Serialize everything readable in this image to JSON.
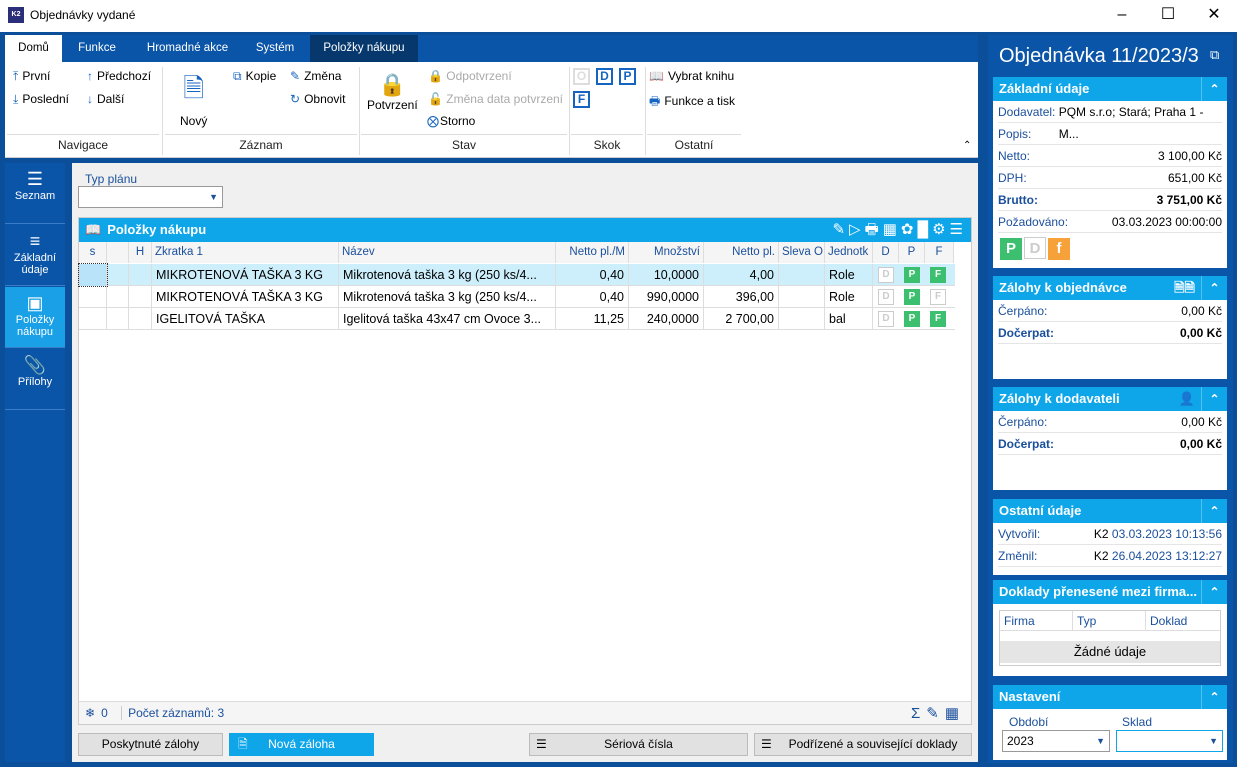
{
  "window": {
    "title": "Objednávky vydané",
    "logo": "K2"
  },
  "tabs": [
    "Domů",
    "Funkce",
    "Hromadné akce",
    "Systém",
    "Položky nákupu"
  ],
  "ribbon": {
    "nav": {
      "first": "První",
      "prev": "Předchozí",
      "last": "Poslední",
      "next": "Další",
      "group": "Navigace"
    },
    "record": {
      "new": "Nový",
      "copy": "Kopie",
      "edit": "Změna",
      "refresh": "Obnovit",
      "group": "Záznam"
    },
    "state": {
      "confirm": "Potvrzení",
      "unconfirm": "Odpotvrzení",
      "change_date": "Změna data potvrzení",
      "cancel": "Storno",
      "group": "Stav"
    },
    "jump": {
      "o": "O",
      "d": "D",
      "p": "P",
      "f": "F",
      "group": "Skok"
    },
    "other": {
      "book": "Vybrat knihu",
      "print": "Funkce a tisk",
      "group": "Ostatní"
    }
  },
  "sidebar": [
    {
      "label": "Seznam",
      "icon": "list-icon"
    },
    {
      "label": "Základní údaje",
      "icon": "details-icon"
    },
    {
      "label": "Položky nákupu",
      "icon": "box-icon"
    },
    {
      "label": "Přílohy",
      "icon": "paperclip-icon"
    }
  ],
  "filter": {
    "label": "Typ plánu",
    "value": ""
  },
  "grid": {
    "title": "Položky nákupu",
    "columns": [
      "s",
      "",
      "H",
      "Zkratka 1",
      "Název",
      "Netto pl./M",
      "Množství",
      "Netto pl.",
      "Sleva O",
      "Jednotk",
      "D",
      "P",
      "F"
    ],
    "rows": [
      {
        "zkratka": "MIKROTENOVÁ TAŠKA 3 KG",
        "nazev": "Mikrotenová taška 3 kg (250 ks/4...",
        "netto_m": "0,40",
        "mnozstvi": "10,0000",
        "netto": "4,00",
        "sleva": "",
        "jednotka": "Role",
        "d": "D",
        "p": "P",
        "f": "F",
        "f_on": true,
        "selected": true
      },
      {
        "zkratka": "MIKROTENOVÁ TAŠKA 3 KG",
        "nazev": "Mikrotenová taška 3 kg (250 ks/4...",
        "netto_m": "0,40",
        "mnozstvi": "990,0000",
        "netto": "396,00",
        "sleva": "",
        "jednotka": "Role",
        "d": "D",
        "p": "P",
        "f": "F",
        "f_on": false,
        "selected": false
      },
      {
        "zkratka": "IGELITOVÁ TAŠKA",
        "nazev": "Igelitová taška 43x47 cm Ovoce 3...",
        "netto_m": "11,25",
        "mnozstvi": "240,0000",
        "netto": "2 700,00",
        "sleva": "",
        "jednotka": "bal",
        "d": "D",
        "p": "P",
        "f": "F",
        "f_on": true,
        "selected": false
      }
    ],
    "footer": {
      "count": "0",
      "records": "Počet záznamů: 3"
    }
  },
  "buttons": {
    "advances": "Poskytnuté zálohy",
    "new_advance": "Nová záloha",
    "serial": "Sériová čísla",
    "related": "Podřízené a související doklady"
  },
  "right": {
    "title": "Objednávka 11/2023/3",
    "basic": {
      "head": "Základní údaje",
      "supplier_k": "Dodavatel:",
      "supplier_v": "PQM s.r.o; Stará; Praha 1 - M...",
      "desc_k": "Popis:",
      "netto_k": "Netto:",
      "netto_v": "3 100,00 Kč",
      "dph_k": "DPH:",
      "dph_v": "651,00 Kč",
      "brutto_k": "Brutto:",
      "brutto_v": "3 751,00 Kč",
      "req_k": "Požadováno:",
      "req_v": "03.03.2023 00:00:00",
      "flags": [
        "P",
        "D",
        "f"
      ]
    },
    "adv_order": {
      "head": "Zálohy k objednávce",
      "k1": "Čerpáno:",
      "v1": "0,00 Kč",
      "k2": "Dočerpat:",
      "v2": "0,00 Kč"
    },
    "adv_supplier": {
      "head": "Zálohy k dodavateli",
      "k1": "Čerpáno:",
      "v1": "0,00 Kč",
      "k2": "Dočerpat:",
      "v2": "0,00 Kč"
    },
    "other": {
      "head": "Ostatní údaje",
      "k1": "Vytvořil:",
      "u1": "K2",
      "v1": "03.03.2023 10:13:56",
      "k2": "Změnil:",
      "u2": "K2",
      "v2": "26.04.2023 13:12:27"
    },
    "transfer": {
      "head": "Doklady přenesené mezi firma...",
      "cols": [
        "Firma",
        "Typ",
        "Doklad"
      ],
      "empty": "Žádné údaje"
    },
    "settings": {
      "head": "Nastavení",
      "period_k": "Období",
      "period_v": "2023",
      "store_k": "Sklad",
      "store_v": ""
    }
  },
  "colors": {
    "dark_blue": "#0b55a8",
    "cyan": "#0ea5e9",
    "green": "#3cbf6e",
    "orange": "#f7a13b"
  }
}
